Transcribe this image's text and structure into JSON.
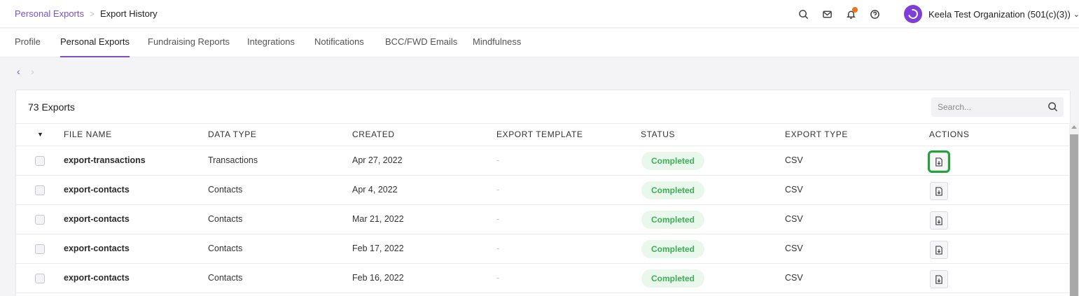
{
  "breadcrumb": {
    "parent": "Personal Exports",
    "separator": ">",
    "current": "Export History"
  },
  "header": {
    "org_name": "Keela Test Organization (501(c)(3))",
    "org_caret": "⌄"
  },
  "tabs": [
    {
      "label": "Profile",
      "active": false
    },
    {
      "label": "Personal Exports",
      "active": true
    },
    {
      "label": "Fundraising Reports",
      "active": false
    },
    {
      "label": "Integrations",
      "active": false
    },
    {
      "label": "Notifications",
      "active": false
    },
    {
      "label": "BCC/FWD Emails",
      "active": false
    },
    {
      "label": "Mindfulness",
      "active": false
    }
  ],
  "pager": {
    "prev": "‹",
    "next": "›"
  },
  "exports": {
    "count_label": "73 Exports",
    "search_placeholder": "Search...",
    "columns": [
      "FILE NAME",
      "DATA TYPE",
      "CREATED",
      "EXPORT TEMPLATE",
      "STATUS",
      "EXPORT TYPE",
      "ACTIONS"
    ],
    "rows": [
      {
        "file_name": "export-transactions",
        "data_type": "Transactions",
        "created": "Apr 27, 2022",
        "template": "-",
        "status": "Completed",
        "export_type": "CSV"
      },
      {
        "file_name": "export-contacts",
        "data_type": "Contacts",
        "created": "Apr 4, 2022",
        "template": "-",
        "status": "Completed",
        "export_type": "CSV"
      },
      {
        "file_name": "export-contacts",
        "data_type": "Contacts",
        "created": "Mar 21, 2022",
        "template": "-",
        "status": "Completed",
        "export_type": "CSV"
      },
      {
        "file_name": "export-contacts",
        "data_type": "Contacts",
        "created": "Feb 17, 2022",
        "template": "-",
        "status": "Completed",
        "export_type": "CSV"
      },
      {
        "file_name": "export-contacts",
        "data_type": "Contacts",
        "created": "Feb 16, 2022",
        "template": "-",
        "status": "Completed",
        "export_type": "CSV"
      }
    ]
  },
  "icons": {
    "top": [
      "search-icon",
      "mail-icon",
      "bell-icon",
      "help-icon"
    ],
    "action": "download-file-icon"
  },
  "colors": {
    "accent": "#7b4fd6",
    "status_green": "#3cae55",
    "notification": "#f07316",
    "highlight": "#1fa53a"
  }
}
